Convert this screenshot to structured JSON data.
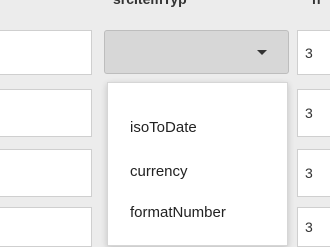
{
  "header": {
    "column_middle_label": "srcItemTyp",
    "column_right_label": "n"
  },
  "rows": [
    {
      "right_value": "3"
    },
    {
      "right_value": "3"
    },
    {
      "right_value": "3"
    },
    {
      "right_value": "3"
    }
  ],
  "dropdown": {
    "selected_value": "",
    "options": [
      "isoToDate",
      "currency",
      "formatNumber"
    ]
  }
}
